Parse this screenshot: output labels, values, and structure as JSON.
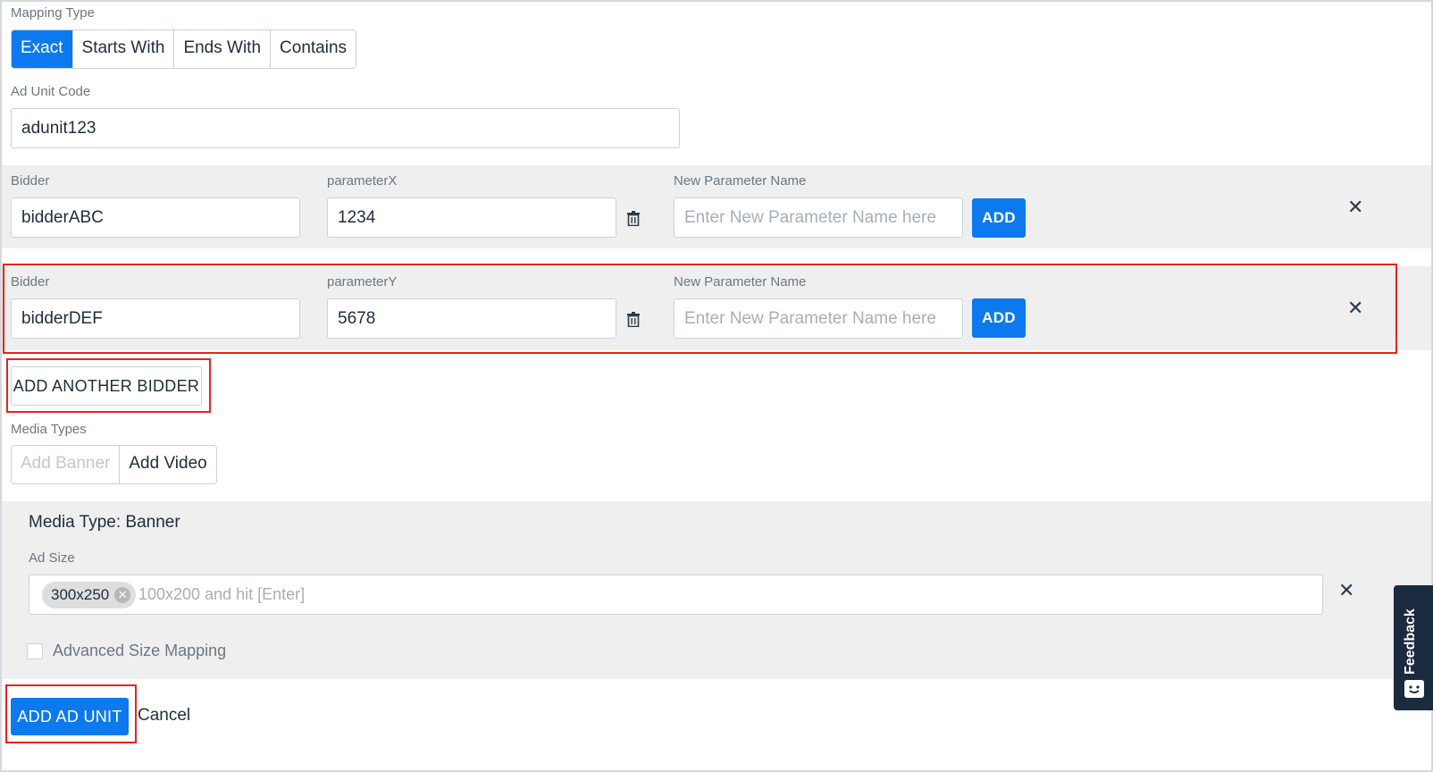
{
  "mapping_type": {
    "label": "Mapping Type",
    "options": [
      "Exact",
      "Starts With",
      "Ends With",
      "Contains"
    ],
    "selected": "Exact"
  },
  "ad_unit_code": {
    "label": "Ad Unit Code",
    "value": "adunit123"
  },
  "bidders": [
    {
      "bidder_label": "Bidder",
      "bidder_value": "bidderABC",
      "param_label": "parameterX",
      "param_value": "1234",
      "new_param_label": "New Parameter Name",
      "new_param_placeholder": "Enter New Parameter Name here",
      "add_label": "ADD"
    },
    {
      "bidder_label": "Bidder",
      "bidder_value": "bidderDEF",
      "param_label": "parameterY",
      "param_value": "5678",
      "new_param_label": "New Parameter Name",
      "new_param_placeholder": "Enter New Parameter Name here",
      "add_label": "ADD"
    }
  ],
  "add_another_bidder_label": "ADD ANOTHER BIDDER",
  "media_types": {
    "label": "Media Types",
    "options": [
      "Add Banner",
      "Add Video"
    ],
    "disabled": "Add Banner"
  },
  "banner": {
    "title": "Media Type: Banner",
    "ad_size_label": "Ad Size",
    "chip": "300x250",
    "placeholder": "100x200 and hit [Enter]",
    "advanced_label": "Advanced Size Mapping"
  },
  "footer": {
    "add_ad_unit_label": "ADD AD UNIT",
    "cancel_label": "Cancel"
  },
  "feedback_label": "Feedback",
  "colors": {
    "primary": "#0d79ee",
    "highlight": "#e8231c",
    "band": "#efefef",
    "feedback_bg": "#1b2b3f"
  }
}
